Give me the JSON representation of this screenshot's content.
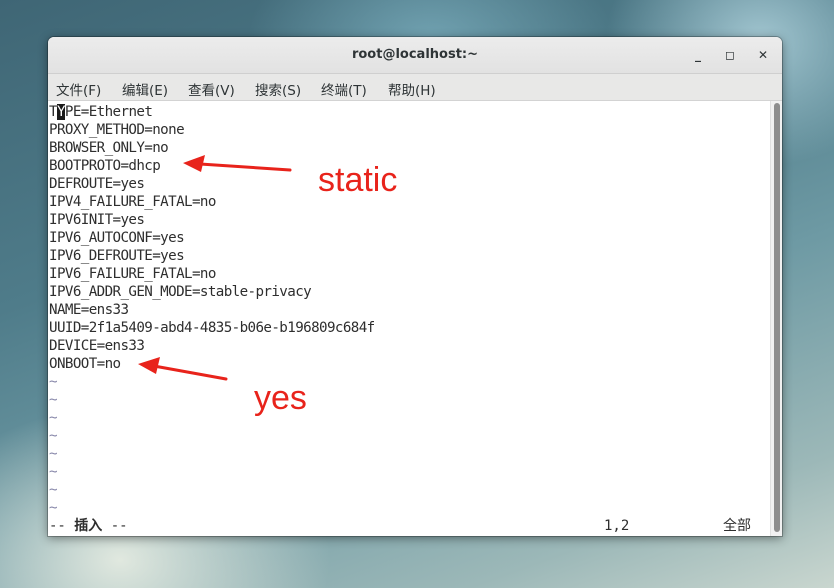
{
  "window": {
    "title": "root@localhost:~",
    "minimize_label": "_",
    "maximize_label": "◻",
    "close_label": "✕"
  },
  "menubar": {
    "items": [
      {
        "label": "文件(F)"
      },
      {
        "label": "编辑(E)"
      },
      {
        "label": "查看(V)"
      },
      {
        "label": "搜索(S)"
      },
      {
        "label": "终端(T)"
      },
      {
        "label": "帮助(H)"
      }
    ]
  },
  "terminal": {
    "cursor_char": "Y",
    "first_line_before_cursor": "T",
    "first_line_after_cursor": "PE=Ethernet",
    "lines": [
      "PROXY_METHOD=none",
      "BROWSER_ONLY=no",
      "BOOTPROTO=dhcp",
      "DEFROUTE=yes",
      "IPV4_FAILURE_FATAL=no",
      "IPV6INIT=yes",
      "IPV6_AUTOCONF=yes",
      "IPV6_DEFROUTE=yes",
      "IPV6_FAILURE_FATAL=no",
      "IPV6_ADDR_GEN_MODE=stable-privacy",
      "NAME=ens33",
      "UUID=2f1a5409-abd4-4835-b06e-b196809c684f",
      "DEVICE=ens33",
      "ONBOOT=no"
    ],
    "tildes": [
      "~",
      "~",
      "~",
      "~",
      "~",
      "~",
      "~",
      "~"
    ],
    "status": {
      "mode_prefix": "-- ",
      "mode": "插入",
      "mode_suffix": " --",
      "position": "1,2",
      "scroll": "全部"
    }
  },
  "annotations": {
    "static_label": "static",
    "yes_label": "yes",
    "color": "#e8231b"
  }
}
